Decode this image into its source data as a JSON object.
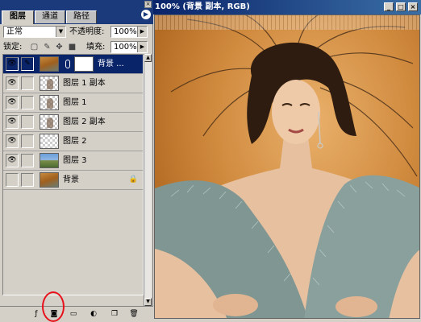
{
  "palette": {
    "tabs": [
      "图层",
      "通道",
      "路径"
    ],
    "blend_mode": "正常",
    "opacity_label": "不透明度:",
    "opacity_value": "100%",
    "lock_label": "锁定:",
    "fill_label": "填充:",
    "fill_value": "100%",
    "layers": [
      {
        "name": "背景 ...",
        "selected": true,
        "visible": true,
        "thumb": "photo"
      },
      {
        "name": "图层 1 副本",
        "selected": false,
        "visible": true,
        "thumb": "fig"
      },
      {
        "name": "图层 1",
        "selected": false,
        "visible": true,
        "thumb": "fig"
      },
      {
        "name": "图层 2 副本",
        "selected": false,
        "visible": true,
        "thumb": "fig"
      },
      {
        "name": "图层 2",
        "selected": false,
        "visible": true,
        "thumb": "checker"
      },
      {
        "name": "图层 3",
        "selected": false,
        "visible": true,
        "thumb": "landscape"
      },
      {
        "name": "背景",
        "selected": false,
        "visible": false,
        "thumb": "photo"
      }
    ],
    "bottom_tools": [
      "layer-style-icon",
      "add-mask-icon",
      "new-group-icon",
      "adjustment-layer-icon",
      "new-layer-icon",
      "delete-layer-icon"
    ]
  },
  "document": {
    "title": "100% (背景 副本, RGB)"
  },
  "colors": {
    "palette_bg": "#d4d0c8",
    "selection": "#0a246a",
    "highlight_circle": "#e8101a"
  }
}
